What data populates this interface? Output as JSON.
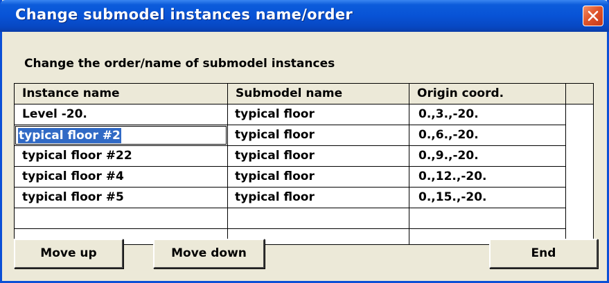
{
  "window": {
    "title": "Change submodel instances name/order"
  },
  "subtitle": "Change the order/name of submodel instances",
  "table": {
    "columns": [
      "Instance name",
      "Submodel name",
      "Origin coord."
    ],
    "rows": [
      [
        "Level -20.",
        "typical floor",
        "0.,3.,-20."
      ],
      [
        "typical floor #2",
        "typical floor",
        "0.,6.,-20."
      ],
      [
        "typical floor #22",
        "typical floor",
        "0.,9.,-20."
      ],
      [
        "typical floor #4",
        "typical floor",
        "0.,12.,-20."
      ],
      [
        "typical floor #5",
        "typical floor",
        "0.,15.,-20."
      ]
    ],
    "editing": {
      "row": 1,
      "value": "typical floor #2"
    }
  },
  "buttons": {
    "move_up": "Move up",
    "move_down": "Move down",
    "end": "End"
  },
  "icons": {
    "close": "close-icon"
  },
  "colors": {
    "titlebar": "#0853d6",
    "selection": "#316ac5",
    "dialog_bg": "#ece9d8",
    "close_button": "#e0552a"
  }
}
